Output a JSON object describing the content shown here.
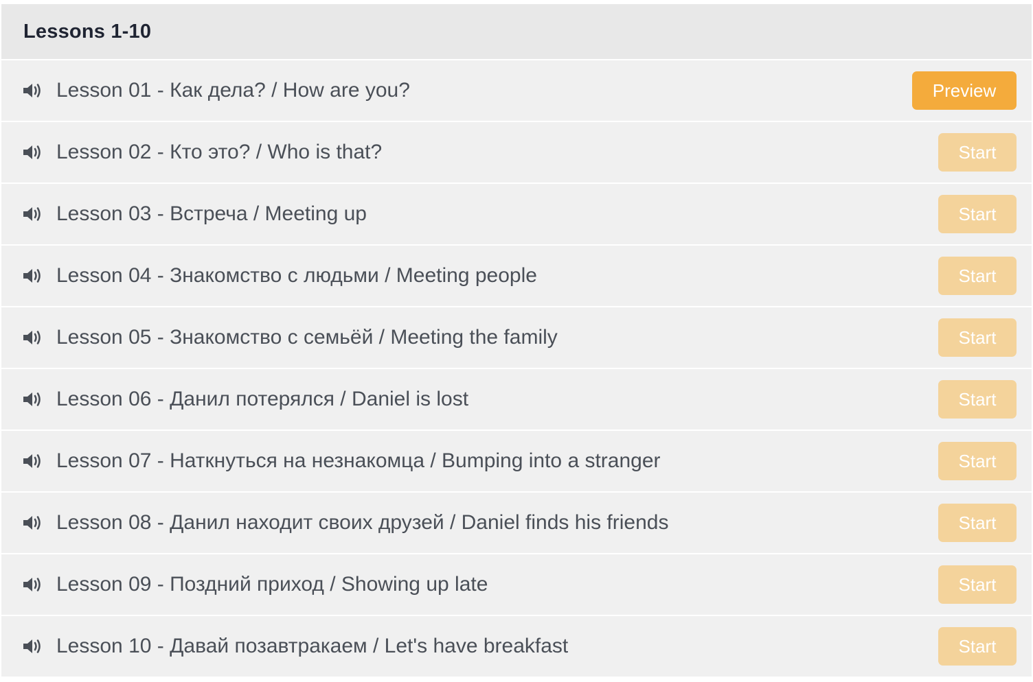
{
  "section": {
    "title": "Lessons 1-10"
  },
  "icons": {
    "lesson_icon": "speaker-volume-icon"
  },
  "colors": {
    "header_bg": "#e8e8e8",
    "row_bg": "#f0f0f0",
    "preview_button": "#f4ab3c",
    "start_button": "#f4d39b",
    "title_text": "#1f2432",
    "lesson_text": "#4a4f57"
  },
  "lessons": [
    {
      "title": "Lesson 01 - Как дела? / How are you?",
      "button_label": "Preview",
      "button_type": "preview"
    },
    {
      "title": "Lesson 02 - Кто это? / Who is that?",
      "button_label": "Start",
      "button_type": "start"
    },
    {
      "title": "Lesson 03 - Встреча / Meeting up",
      "button_label": "Start",
      "button_type": "start"
    },
    {
      "title": "Lesson 04 - Знакомство с людьми / Meeting people",
      "button_label": "Start",
      "button_type": "start"
    },
    {
      "title": "Lesson 05 - Знакомство с семьёй / Meeting the family",
      "button_label": "Start",
      "button_type": "start"
    },
    {
      "title": "Lesson 06 - Данил потерялся / Daniel is lost",
      "button_label": "Start",
      "button_type": "start"
    },
    {
      "title": "Lesson 07 - Наткнуться на незнакомца / Bumping into a stranger",
      "button_label": "Start",
      "button_type": "start"
    },
    {
      "title": "Lesson 08 - Данил находит своих друзей / Daniel finds his friends",
      "button_label": "Start",
      "button_type": "start"
    },
    {
      "title": "Lesson 09 - Поздний приход / Showing up late",
      "button_label": "Start",
      "button_type": "start"
    },
    {
      "title": "Lesson 10 - Давай позавтракаем / Let's have breakfast",
      "button_label": "Start",
      "button_type": "start"
    }
  ]
}
